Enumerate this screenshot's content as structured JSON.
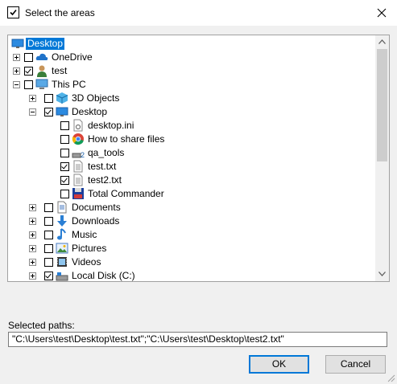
{
  "window": {
    "title": "Select the areas"
  },
  "tree": {
    "items": [
      {
        "label": "Desktop",
        "selected": true,
        "icon": "desktop-icon"
      },
      {
        "label": "OneDrive",
        "checked": false,
        "icon": "cloud-icon"
      },
      {
        "label": "test",
        "checked": true,
        "icon": "user-icon"
      },
      {
        "label": "This PC",
        "checked": false,
        "icon": "computer-icon"
      },
      {
        "label": "3D Objects",
        "checked": false,
        "icon": "cube-icon"
      },
      {
        "label": "Desktop",
        "checked": true,
        "icon": "desktop-icon"
      },
      {
        "label": "desktop.ini",
        "checked": false,
        "icon": "settings-file-icon"
      },
      {
        "label": "How to share files",
        "checked": false,
        "icon": "chrome-icon"
      },
      {
        "label": "qa_tools",
        "checked": false,
        "icon": "drive-icon"
      },
      {
        "label": "test.txt",
        "checked": true,
        "icon": "text-file-icon"
      },
      {
        "label": "test2.txt",
        "checked": true,
        "icon": "text-file-icon"
      },
      {
        "label": "Total Commander",
        "checked": false,
        "icon": "floppy-icon"
      },
      {
        "label": "Documents",
        "checked": false,
        "icon": "documents-icon"
      },
      {
        "label": "Downloads",
        "checked": false,
        "icon": "downloads-icon"
      },
      {
        "label": "Music",
        "checked": false,
        "icon": "music-icon"
      },
      {
        "label": "Pictures",
        "checked": false,
        "icon": "pictures-icon"
      },
      {
        "label": "Videos",
        "checked": false,
        "icon": "videos-icon"
      },
      {
        "label": "Local Disk (C:)",
        "checked": true,
        "icon": "disk-icon"
      }
    ]
  },
  "selected_paths": {
    "label": "Selected paths:",
    "value": "\"C:\\Users\\test\\Desktop\\test.txt\";\"C:\\Users\\test\\Desktop\\test2.txt\""
  },
  "buttons": {
    "ok": "OK",
    "cancel": "Cancel"
  },
  "colors": {
    "selection": "#0078d7",
    "accent": "#0078d7"
  }
}
